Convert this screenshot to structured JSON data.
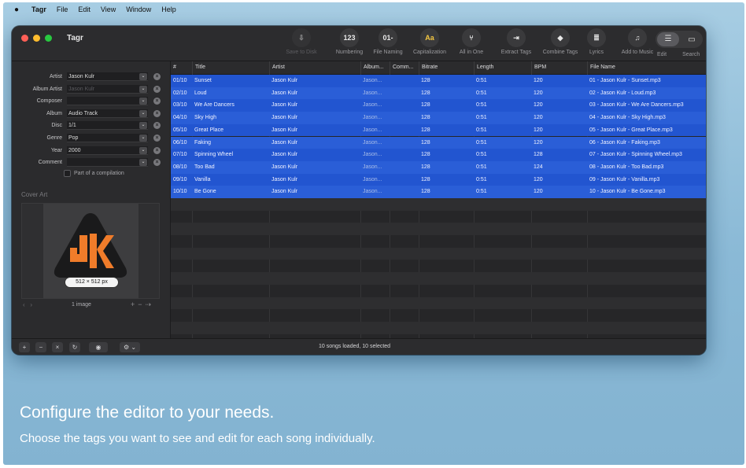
{
  "menubar": {
    "apple": "",
    "app": "Tagr",
    "items": [
      "File",
      "Edit",
      "View",
      "Window",
      "Help"
    ]
  },
  "window": {
    "title": "Tagr"
  },
  "toolbar": [
    {
      "label": "Save to Disk",
      "icon": "save-disk-icon",
      "glyph": "⇩",
      "disabled": true
    },
    {
      "label": "Numbering",
      "icon": "numbering-icon",
      "glyph": "123",
      "disabled": false
    },
    {
      "label": "File Naming",
      "icon": "file-naming-icon",
      "glyph": "01-",
      "disabled": false
    },
    {
      "label": "Capitalization",
      "icon": "capitalization-icon",
      "glyph": "Aa",
      "disabled": false
    },
    {
      "label": "All in One",
      "icon": "all-in-one-icon",
      "glyph": "⑂",
      "disabled": false
    },
    {
      "label": "Extract Tags",
      "icon": "extract-tags-icon",
      "glyph": "⇥",
      "disabled": false
    },
    {
      "label": "Combine Tags",
      "icon": "combine-tags-icon",
      "glyph": "◆",
      "disabled": false
    },
    {
      "label": "Lyrics",
      "icon": "lyrics-icon",
      "glyph": "≣",
      "disabled": false
    },
    {
      "label": "Add to Music",
      "icon": "music-note-icon",
      "glyph": "♫",
      "disabled": false
    }
  ],
  "view_toggle": {
    "edit_label": "Edit",
    "search_label": "Search"
  },
  "fields": [
    {
      "label": "Artist",
      "value": "Jason Kulr",
      "placeholder": false
    },
    {
      "label": "Album Artist",
      "value": "Jason Kulr",
      "placeholder": true
    },
    {
      "label": "Composer",
      "value": "",
      "placeholder": false
    },
    {
      "label": "Album",
      "value": "Audio Track",
      "placeholder": false
    },
    {
      "label": "Disc",
      "value": "1/1",
      "placeholder": false
    },
    {
      "label": "Genre",
      "value": "Pop",
      "placeholder": false
    },
    {
      "label": "Year",
      "value": "2000",
      "placeholder": false
    },
    {
      "label": "Comment",
      "value": "",
      "placeholder": false
    }
  ],
  "compilation_label": "Part of a compilation",
  "cover": {
    "title": "Cover Art",
    "size_badge": "512 × 512 px",
    "count": "1 image",
    "accent": "#f07c2a",
    "logo_dark": "#1a1a1b"
  },
  "table": {
    "columns": [
      "#",
      "Title",
      "Artist",
      "Album...",
      "Comm...",
      "Bitrate",
      "Length",
      "BPM",
      "File Name"
    ],
    "rows": [
      [
        "01/10",
        "Sunset",
        "Jason Kulr",
        "Jason...",
        "",
        "128",
        "0:51",
        "120",
        "01 - Jason Kulr - Sunset.mp3"
      ],
      [
        "02/10",
        "Loud",
        "Jason Kulr",
        "Jason...",
        "",
        "128",
        "0:51",
        "120",
        "02 - Jason Kulr - Loud.mp3"
      ],
      [
        "03/10",
        "We Are Dancers",
        "Jason Kulr",
        "Jason...",
        "",
        "128",
        "0:51",
        "120",
        "03 - Jason Kulr - We Are Dancers.mp3"
      ],
      [
        "04/10",
        "Sky High",
        "Jason Kulr",
        "Jason...",
        "",
        "128",
        "0:51",
        "120",
        "04 - Jason Kulr - Sky High.mp3"
      ],
      [
        "05/10",
        "Great Place",
        "Jason Kulr",
        "Jason...",
        "",
        "128",
        "0:51",
        "120",
        "05 - Jason Kulr - Great Place.mp3"
      ],
      [
        "06/10",
        "Faking",
        "Jason Kulr",
        "Jason...",
        "",
        "128",
        "0:51",
        "120",
        "06 - Jason Kulr - Faking.mp3"
      ],
      [
        "07/10",
        "Spinning Wheel",
        "Jason Kulr",
        "Jason...",
        "",
        "128",
        "0:51",
        "128",
        "07 - Jason Kulr - Spinning Wheel.mp3"
      ],
      [
        "08/10",
        "Too Bad",
        "Jason Kulr",
        "Jason...",
        "",
        "128",
        "0:51",
        "124",
        "08 - Jason Kulr - Too Bad.mp3"
      ],
      [
        "09/10",
        "Vanilla",
        "Jason Kulr",
        "Jason...",
        "",
        "128",
        "0:51",
        "120",
        "09 - Jason Kulr - Vanilla.mp3"
      ],
      [
        "10/10",
        "Be Gone",
        "Jason Kulr",
        "Jason...",
        "",
        "128",
        "0:51",
        "120",
        "10 - Jason Kulr - Be Gone.mp3"
      ]
    ],
    "selection_color": "#2255d0"
  },
  "bottombar": {
    "add": "+",
    "remove": "−",
    "close": "×",
    "refresh": "↻",
    "preview": "◉",
    "gear": "⚙ ⌄",
    "status": "10 songs loaded, 10 selected"
  },
  "caption": {
    "headline": "Configure the editor to your needs.",
    "subline": "Choose the tags you want to see and edit for each song individually."
  }
}
